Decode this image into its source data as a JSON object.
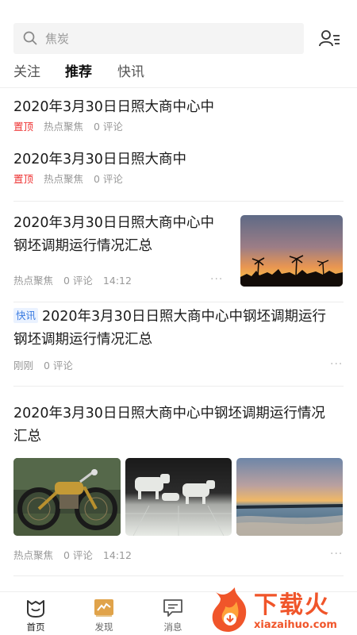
{
  "search": {
    "placeholder": "焦炭",
    "icon": "search-icon",
    "user_icon": "user-list-icon"
  },
  "tabs": [
    {
      "label": "关注",
      "active": false
    },
    {
      "label": "推荐",
      "active": true
    },
    {
      "label": "快讯",
      "active": false
    }
  ],
  "feed": {
    "pinned": [
      {
        "title": "2020年3月30日日照大商中心中",
        "pin": "置顶",
        "source": "热点聚焦",
        "comments": "0 评论"
      },
      {
        "title": "2020年3月30日日照大商中",
        "pin": "置顶",
        "source": "热点聚焦",
        "comments": "0 评论"
      }
    ],
    "article1": {
      "title_line1": "2020年3月30日日照大商中心中",
      "title_line2": "钢坯调期运行情况汇总",
      "source": "热点聚焦",
      "comments": "0 评论",
      "time": "14:12",
      "image": "sunset-palm-trees"
    },
    "flash": {
      "tag": "快讯",
      "title_line1": "2020年3月30日日照大商中心中钢坯调期运行",
      "title_line2": "钢坯调期运行情况汇总",
      "time": "刚刚",
      "comments": "0 评论"
    },
    "article2": {
      "title_line1": "2020年3月30日日照大商中心中钢坯调期运行情况",
      "title_line2": "汇总",
      "source": "热点聚焦",
      "comments": "0 评论",
      "time": "14:12",
      "images": [
        "vintage-motorcycle",
        "cow-figurines",
        "ocean-sunset"
      ]
    },
    "more_icon": "···"
  },
  "nav": [
    {
      "label": "首页",
      "icon": "home-icon",
      "active": true
    },
    {
      "label": "发现",
      "icon": "discover-icon",
      "active": false
    },
    {
      "label": "消息",
      "icon": "message-icon",
      "active": false
    }
  ],
  "watermark": {
    "brand": "下载火",
    "domain": "xiazaihuo.com"
  },
  "colors": {
    "pin": "#e33333",
    "flash_tag": "#3a7be0",
    "discover_accent": "#e0a34a"
  }
}
